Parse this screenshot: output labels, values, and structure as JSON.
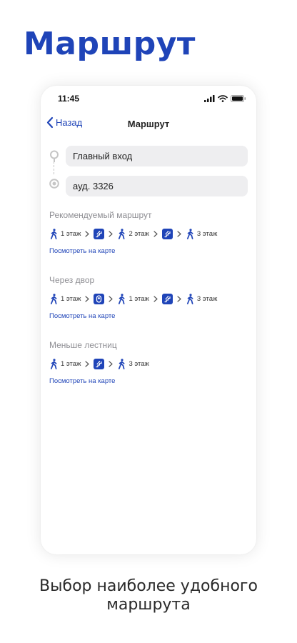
{
  "hero": {
    "title": "Маршрут"
  },
  "status": {
    "time": "11:45"
  },
  "nav": {
    "back_label": "Назад",
    "title": "Маршрут"
  },
  "inputs": {
    "from": "Главный вход",
    "to": "ауд. 3326"
  },
  "routes": [
    {
      "title": "Рекомендуемый маршрут",
      "steps": [
        {
          "type": "walk",
          "label": "1 этаж"
        },
        {
          "type": "stairs"
        },
        {
          "type": "walk",
          "label": "2 этаж"
        },
        {
          "type": "stairs"
        },
        {
          "type": "walk",
          "label": "3 этаж"
        }
      ],
      "link": "Посмотреть на карте"
    },
    {
      "title": "Через двор",
      "steps": [
        {
          "type": "walk",
          "label": "1 этаж"
        },
        {
          "type": "exit"
        },
        {
          "type": "walk",
          "label": "1 этаж"
        },
        {
          "type": "stairs"
        },
        {
          "type": "walk",
          "label": "3 этаж"
        }
      ],
      "link": "Посмотреть на карте"
    },
    {
      "title": "Меньше лестниц",
      "steps": [
        {
          "type": "walk",
          "label": "1 этаж"
        },
        {
          "type": "stairs"
        },
        {
          "type": "walk",
          "label": "3 этаж"
        }
      ],
      "link": "Посмотреть на карте"
    }
  ],
  "caption": {
    "line1": "Выбор наиболее удобного",
    "line2": "маршрута"
  },
  "colors": {
    "accent": "#1f44b8",
    "field_bg": "#eeeef0",
    "muted": "#8e8e93"
  }
}
